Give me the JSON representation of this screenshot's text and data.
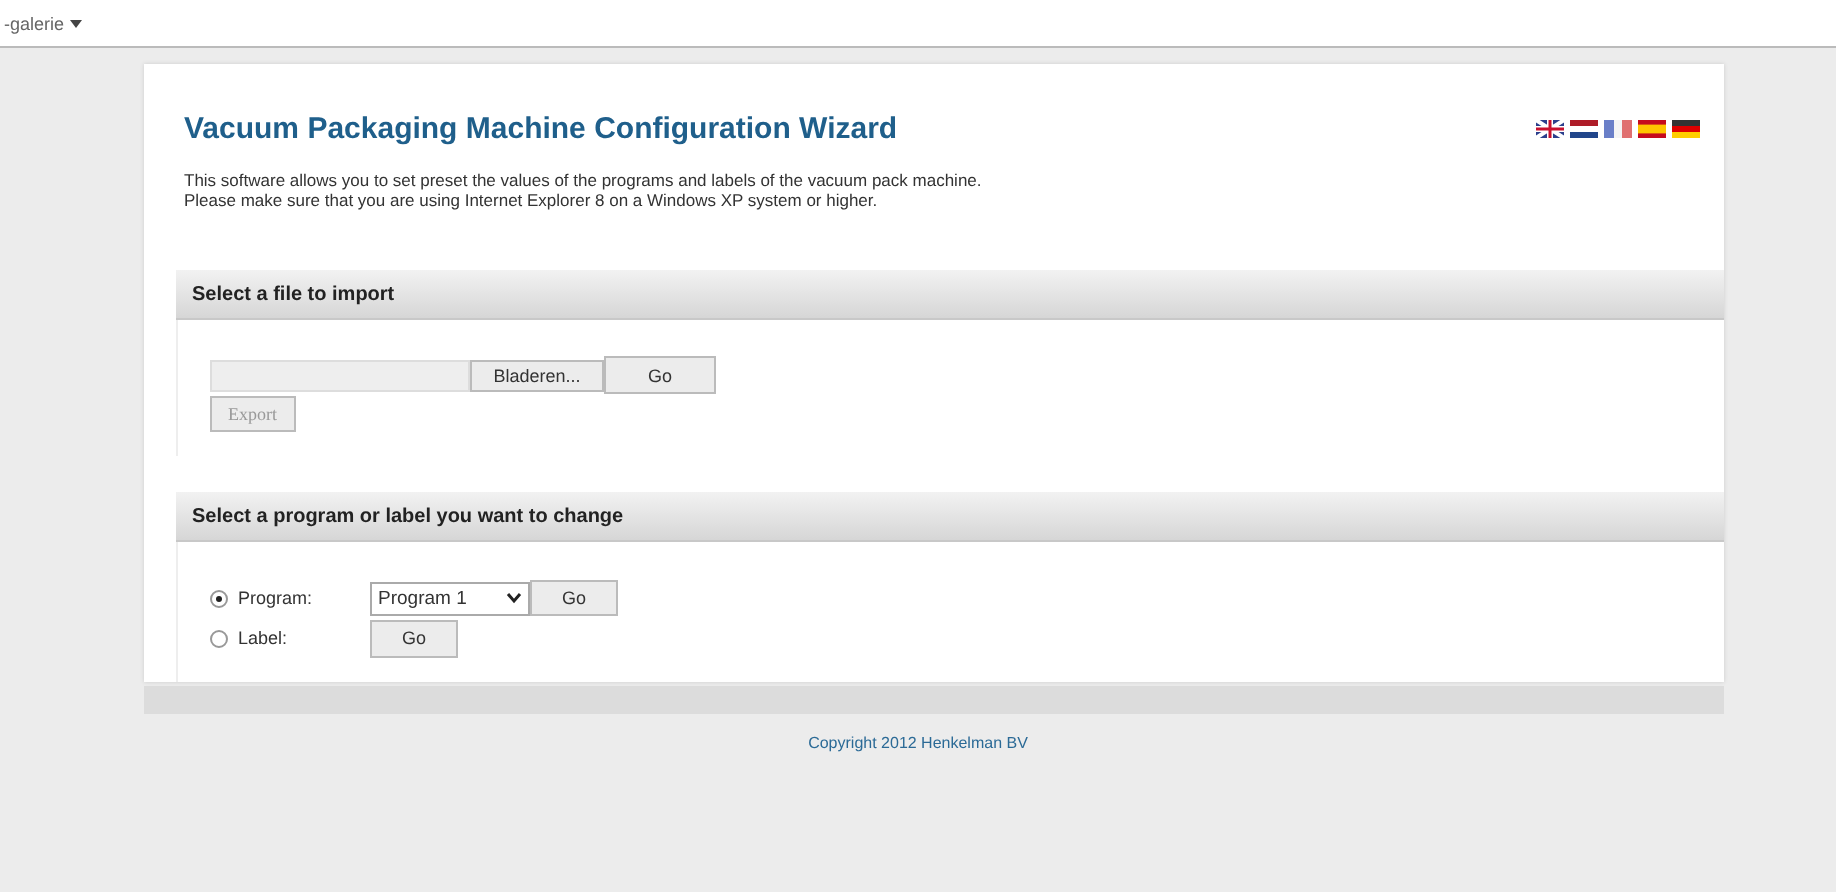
{
  "top_bar": {
    "menu_label": "-galerie"
  },
  "header": {
    "title": "Vacuum Packaging Machine Configuration Wizard",
    "intro_lines": [
      "This software allows you to set preset the values of the programs and labels of the vacuum pack machine.",
      "Please make sure that you are using Internet Explorer 8 on a Windows XP system or higher."
    ]
  },
  "languages": [
    {
      "kind": "uk"
    },
    {
      "kind": "nl"
    },
    {
      "kind": "fr"
    },
    {
      "kind": "es"
    },
    {
      "kind": "de"
    }
  ],
  "import_section": {
    "heading": "Select a file to import",
    "browse_button": "Bladeren...",
    "go_button": "Go",
    "export_button": "Export",
    "export_disabled": true
  },
  "change_section": {
    "heading": "Select a program or label you want to change",
    "options": [
      {
        "label": "Program:",
        "selected": true,
        "dropdown_value": "Program 1",
        "go_button": "Go"
      },
      {
        "label": "Label:",
        "selected": false,
        "go_button": "Go"
      }
    ]
  },
  "footer": {
    "copyright": "Copyright 2012 Henkelman BV"
  }
}
